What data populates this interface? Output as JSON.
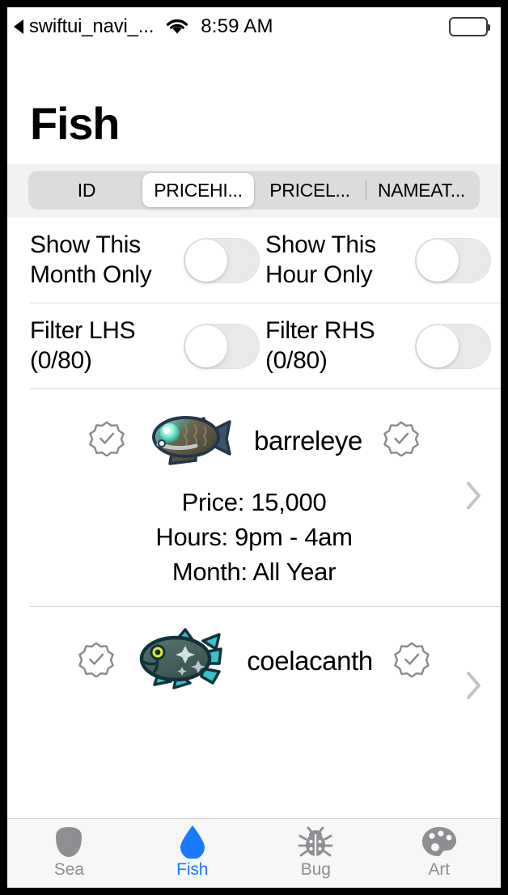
{
  "status_bar": {
    "back_label": "swiftui_navi_...",
    "back_icon": "back-triangle-icon",
    "wifi_icon": "wifi-icon",
    "time": "8:59 AM",
    "battery_icon": "battery-full-icon"
  },
  "header": {
    "title": "Fish"
  },
  "segmented_control": {
    "segments": [
      {
        "label": "ID",
        "selected": false
      },
      {
        "label": "PRICEHI...",
        "selected": true
      },
      {
        "label": "PRICEL...",
        "selected": false
      },
      {
        "label": "NAMEAT...",
        "selected": false
      }
    ]
  },
  "filters": {
    "row1": [
      {
        "label": "Show This Month Only",
        "toggle_on": false
      },
      {
        "label": "Show This Hour Only",
        "toggle_on": false
      }
    ],
    "row2": [
      {
        "label": "Filter LHS (0/80)",
        "toggle_on": false
      },
      {
        "label": "Filter RHS (0/80)",
        "toggle_on": false
      }
    ]
  },
  "list": {
    "items": [
      {
        "name": "barreleye",
        "left_badge_icon": "rosette-check-icon",
        "right_badge_icon": "rosette-check-icon",
        "image_icon": "barreleye-fish-image",
        "price": "Price: 15,000",
        "hours": "Hours: 9pm - 4am",
        "month": "Month: All Year",
        "disclosure_icon": "chevron-right-icon"
      },
      {
        "name": "coelacanth",
        "left_badge_icon": "rosette-check-icon",
        "right_badge_icon": "rosette-check-icon",
        "image_icon": "coelacanth-fish-image",
        "disclosure_icon": "chevron-right-icon"
      }
    ]
  },
  "tab_bar": {
    "tabs": [
      {
        "label": "Sea",
        "icon": "sea-creature-icon",
        "active": false
      },
      {
        "label": "Fish",
        "icon": "water-drop-icon",
        "active": true
      },
      {
        "label": "Bug",
        "icon": "ladybug-icon",
        "active": false
      },
      {
        "label": "Art",
        "icon": "paint-palette-icon",
        "active": false
      }
    ]
  },
  "colors": {
    "accent": "#1a7aff",
    "inactive": "#8e8e93",
    "segment_track": "#dcdcdc",
    "band": "#f2f2f2",
    "switch_track": "#e9e9ea"
  }
}
